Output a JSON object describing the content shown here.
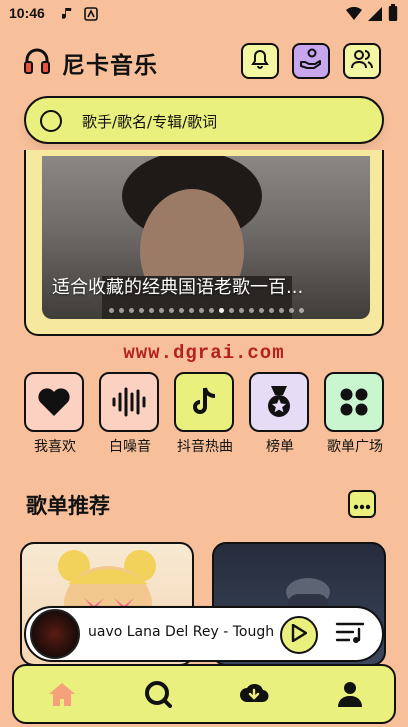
{
  "status_bar": {
    "time": "10:46"
  },
  "header": {
    "title": "尼卡音乐"
  },
  "search": {
    "placeholder": "歌手/歌名/专辑/歌词"
  },
  "banner": {
    "caption": "适合收藏的经典国语老歌一百...",
    "dot_count": 20,
    "active_dot": 11
  },
  "watermark": "www.dgrai.com",
  "quick_actions": [
    {
      "label": "我喜欢",
      "icon": "heart-icon",
      "color": "#fbd2c2"
    },
    {
      "label": "白噪音",
      "icon": "waveform-icon",
      "color": "#fbd2c2"
    },
    {
      "label": "抖音热曲",
      "icon": "tiktok-icon",
      "color": "#eaf07e"
    },
    {
      "label": "榜单",
      "icon": "medal-icon",
      "color": "#e6dcf6"
    },
    {
      "label": "歌单广场",
      "icon": "grid-icon",
      "color": "#c9f5cf"
    }
  ],
  "playlist_section": {
    "title": "歌单推荐"
  },
  "player": {
    "track": "uavo Lana Del Rey - Tough"
  },
  "tab_bar": {
    "items": [
      {
        "icon": "home-icon",
        "color": "#f6a07c"
      },
      {
        "icon": "discover-icon",
        "color": "#111111"
      },
      {
        "icon": "download-icon",
        "color": "#111111"
      },
      {
        "icon": "profile-icon",
        "color": "#111111"
      }
    ]
  }
}
